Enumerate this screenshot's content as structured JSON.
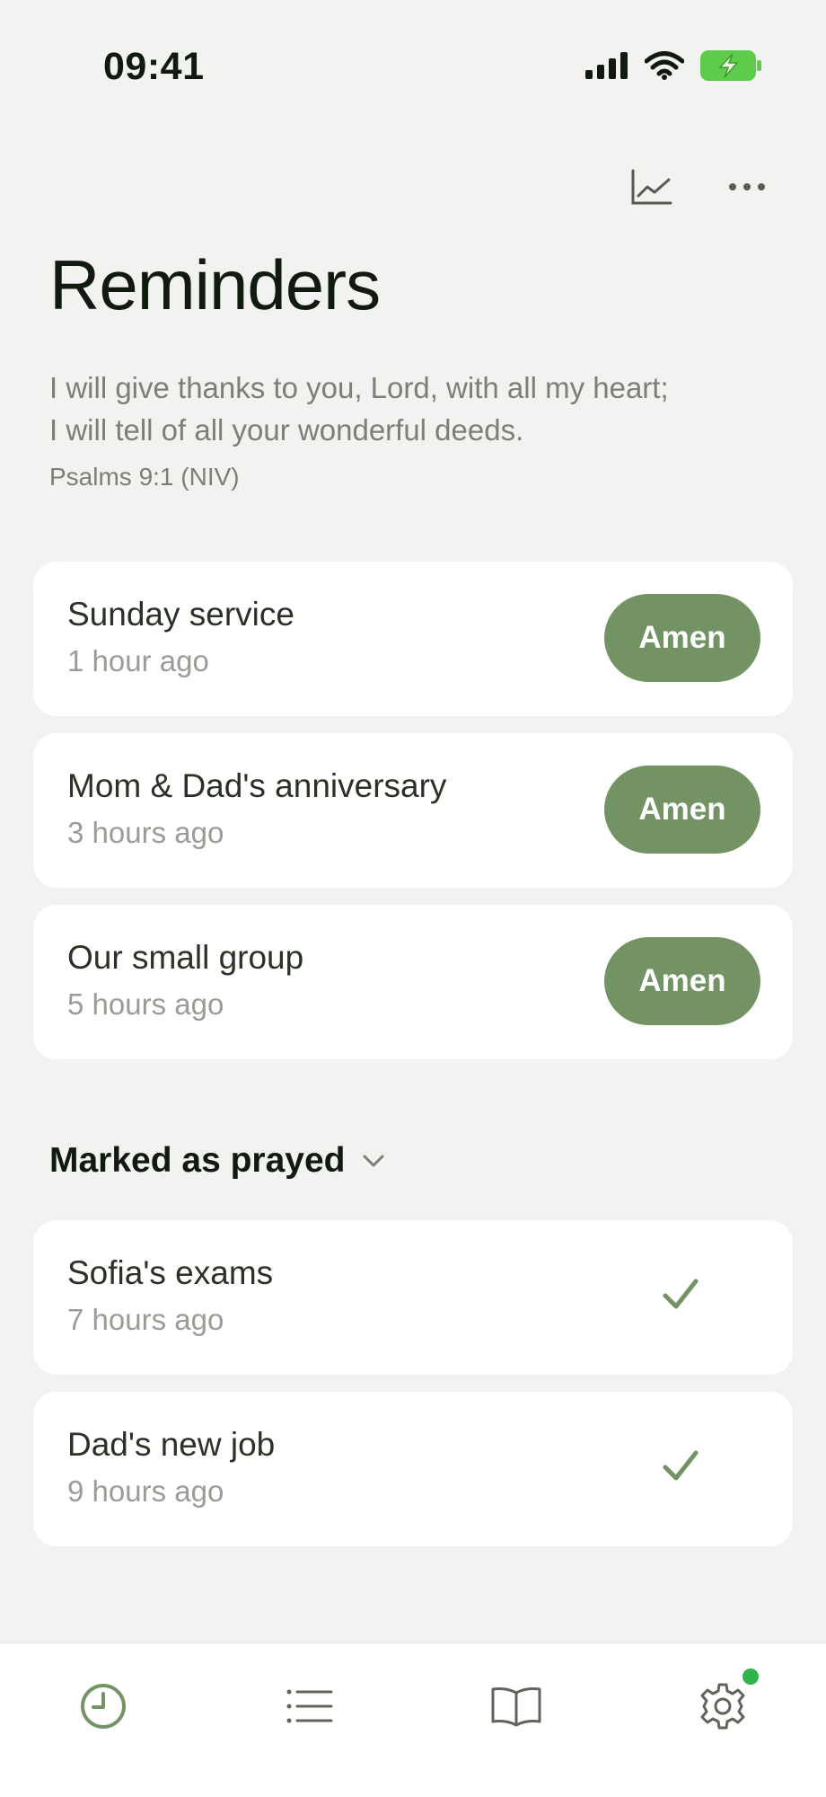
{
  "status_bar": {
    "time": "09:41"
  },
  "header": {
    "title": "Reminders",
    "verse_line1": "I will give thanks to you, Lord, with all my heart;",
    "verse_line2": "I will tell of all your wonderful deeds.",
    "verse_reference": "Psalms 9:1 (NIV)",
    "icons": [
      "chart-icon",
      "more-icon"
    ]
  },
  "reminders": [
    {
      "title": "Sunday service",
      "time": "1 hour ago",
      "action": "Amen"
    },
    {
      "title": "Mom & Dad's anniversary",
      "time": "3 hours ago",
      "action": "Amen"
    },
    {
      "title": "Our small group",
      "time": "5 hours ago",
      "action": "Amen"
    }
  ],
  "prayed_section": {
    "title": "Marked as prayed",
    "items": [
      {
        "title": "Sofia's exams",
        "time": "7 hours ago"
      },
      {
        "title": "Dad's new job",
        "time": "9 hours ago"
      }
    ]
  },
  "tab_bar": {
    "tabs": [
      "clock-icon",
      "list-icon",
      "book-icon",
      "gear-icon"
    ],
    "active": "clock-icon",
    "notification_tab": "gear-icon"
  },
  "colors": {
    "accent": "#749365",
    "background": "#f2f2f0",
    "notification_dot": "#2fb34a",
    "battery": "#5ecb4b"
  }
}
